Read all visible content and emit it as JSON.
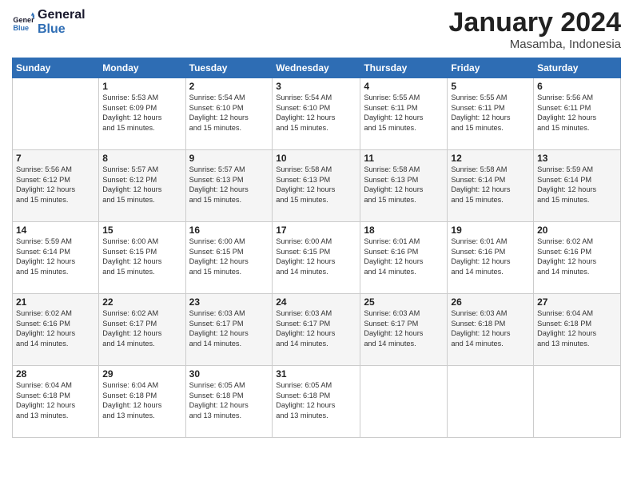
{
  "header": {
    "logo_line1": "General",
    "logo_line2": "Blue",
    "month": "January 2024",
    "location": "Masamba, Indonesia"
  },
  "weekdays": [
    "Sunday",
    "Monday",
    "Tuesday",
    "Wednesday",
    "Thursday",
    "Friday",
    "Saturday"
  ],
  "weeks": [
    [
      {
        "day": "",
        "info": ""
      },
      {
        "day": "1",
        "info": "Sunrise: 5:53 AM\nSunset: 6:09 PM\nDaylight: 12 hours\nand 15 minutes."
      },
      {
        "day": "2",
        "info": "Sunrise: 5:54 AM\nSunset: 6:10 PM\nDaylight: 12 hours\nand 15 minutes."
      },
      {
        "day": "3",
        "info": "Sunrise: 5:54 AM\nSunset: 6:10 PM\nDaylight: 12 hours\nand 15 minutes."
      },
      {
        "day": "4",
        "info": "Sunrise: 5:55 AM\nSunset: 6:11 PM\nDaylight: 12 hours\nand 15 minutes."
      },
      {
        "day": "5",
        "info": "Sunrise: 5:55 AM\nSunset: 6:11 PM\nDaylight: 12 hours\nand 15 minutes."
      },
      {
        "day": "6",
        "info": "Sunrise: 5:56 AM\nSunset: 6:11 PM\nDaylight: 12 hours\nand 15 minutes."
      }
    ],
    [
      {
        "day": "7",
        "info": "Sunrise: 5:56 AM\nSunset: 6:12 PM\nDaylight: 12 hours\nand 15 minutes."
      },
      {
        "day": "8",
        "info": "Sunrise: 5:57 AM\nSunset: 6:12 PM\nDaylight: 12 hours\nand 15 minutes."
      },
      {
        "day": "9",
        "info": "Sunrise: 5:57 AM\nSunset: 6:13 PM\nDaylight: 12 hours\nand 15 minutes."
      },
      {
        "day": "10",
        "info": "Sunrise: 5:58 AM\nSunset: 6:13 PM\nDaylight: 12 hours\nand 15 minutes."
      },
      {
        "day": "11",
        "info": "Sunrise: 5:58 AM\nSunset: 6:13 PM\nDaylight: 12 hours\nand 15 minutes."
      },
      {
        "day": "12",
        "info": "Sunrise: 5:58 AM\nSunset: 6:14 PM\nDaylight: 12 hours\nand 15 minutes."
      },
      {
        "day": "13",
        "info": "Sunrise: 5:59 AM\nSunset: 6:14 PM\nDaylight: 12 hours\nand 15 minutes."
      }
    ],
    [
      {
        "day": "14",
        "info": "Sunrise: 5:59 AM\nSunset: 6:14 PM\nDaylight: 12 hours\nand 15 minutes."
      },
      {
        "day": "15",
        "info": "Sunrise: 6:00 AM\nSunset: 6:15 PM\nDaylight: 12 hours\nand 15 minutes."
      },
      {
        "day": "16",
        "info": "Sunrise: 6:00 AM\nSunset: 6:15 PM\nDaylight: 12 hours\nand 15 minutes."
      },
      {
        "day": "17",
        "info": "Sunrise: 6:00 AM\nSunset: 6:15 PM\nDaylight: 12 hours\nand 14 minutes."
      },
      {
        "day": "18",
        "info": "Sunrise: 6:01 AM\nSunset: 6:16 PM\nDaylight: 12 hours\nand 14 minutes."
      },
      {
        "day": "19",
        "info": "Sunrise: 6:01 AM\nSunset: 6:16 PM\nDaylight: 12 hours\nand 14 minutes."
      },
      {
        "day": "20",
        "info": "Sunrise: 6:02 AM\nSunset: 6:16 PM\nDaylight: 12 hours\nand 14 minutes."
      }
    ],
    [
      {
        "day": "21",
        "info": "Sunrise: 6:02 AM\nSunset: 6:16 PM\nDaylight: 12 hours\nand 14 minutes."
      },
      {
        "day": "22",
        "info": "Sunrise: 6:02 AM\nSunset: 6:17 PM\nDaylight: 12 hours\nand 14 minutes."
      },
      {
        "day": "23",
        "info": "Sunrise: 6:03 AM\nSunset: 6:17 PM\nDaylight: 12 hours\nand 14 minutes."
      },
      {
        "day": "24",
        "info": "Sunrise: 6:03 AM\nSunset: 6:17 PM\nDaylight: 12 hours\nand 14 minutes."
      },
      {
        "day": "25",
        "info": "Sunrise: 6:03 AM\nSunset: 6:17 PM\nDaylight: 12 hours\nand 14 minutes."
      },
      {
        "day": "26",
        "info": "Sunrise: 6:03 AM\nSunset: 6:18 PM\nDaylight: 12 hours\nand 14 minutes."
      },
      {
        "day": "27",
        "info": "Sunrise: 6:04 AM\nSunset: 6:18 PM\nDaylight: 12 hours\nand 13 minutes."
      }
    ],
    [
      {
        "day": "28",
        "info": "Sunrise: 6:04 AM\nSunset: 6:18 PM\nDaylight: 12 hours\nand 13 minutes."
      },
      {
        "day": "29",
        "info": "Sunrise: 6:04 AM\nSunset: 6:18 PM\nDaylight: 12 hours\nand 13 minutes."
      },
      {
        "day": "30",
        "info": "Sunrise: 6:05 AM\nSunset: 6:18 PM\nDaylight: 12 hours\nand 13 minutes."
      },
      {
        "day": "31",
        "info": "Sunrise: 6:05 AM\nSunset: 6:18 PM\nDaylight: 12 hours\nand 13 minutes."
      },
      {
        "day": "",
        "info": ""
      },
      {
        "day": "",
        "info": ""
      },
      {
        "day": "",
        "info": ""
      }
    ]
  ]
}
